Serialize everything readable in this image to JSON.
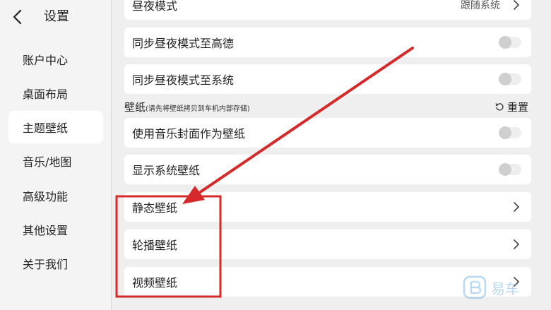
{
  "sidebar": {
    "title": "设置",
    "items": [
      {
        "label": "账户中心"
      },
      {
        "label": "桌面布局"
      },
      {
        "label": "主题壁纸",
        "active": true
      },
      {
        "label": "音乐/地图"
      },
      {
        "label": "高级功能"
      },
      {
        "label": "其他设置"
      },
      {
        "label": "关于我们"
      }
    ]
  },
  "main": {
    "top_row": {
      "label": "昼夜模式",
      "value": "跟随系统"
    },
    "rows_sync": [
      {
        "label": "同步昼夜模式至高德",
        "toggle": false
      },
      {
        "label": "同步昼夜模式至系统",
        "toggle": false
      }
    ],
    "wallpaper_section": {
      "title": "壁纸",
      "note": "(请先将壁纸拷贝到车机内部存储)",
      "reset_label": "重置"
    },
    "rows_wallpaper_toggles": [
      {
        "label": "使用音乐封面作为壁纸",
        "toggle": false
      },
      {
        "label": "显示系统壁纸",
        "toggle": false
      }
    ],
    "rows_wallpaper_links": [
      {
        "label": "静态壁纸"
      },
      {
        "label": "轮播壁纸"
      },
      {
        "label": "视频壁纸"
      }
    ]
  },
  "annotation": {
    "color": "#d42a2a"
  },
  "watermark": {
    "text": "易车",
    "color": "#7fb8e8"
  },
  "colors": {
    "background": "#efefef",
    "card": "#ffffff",
    "sidebar": "#f4f4f4"
  }
}
